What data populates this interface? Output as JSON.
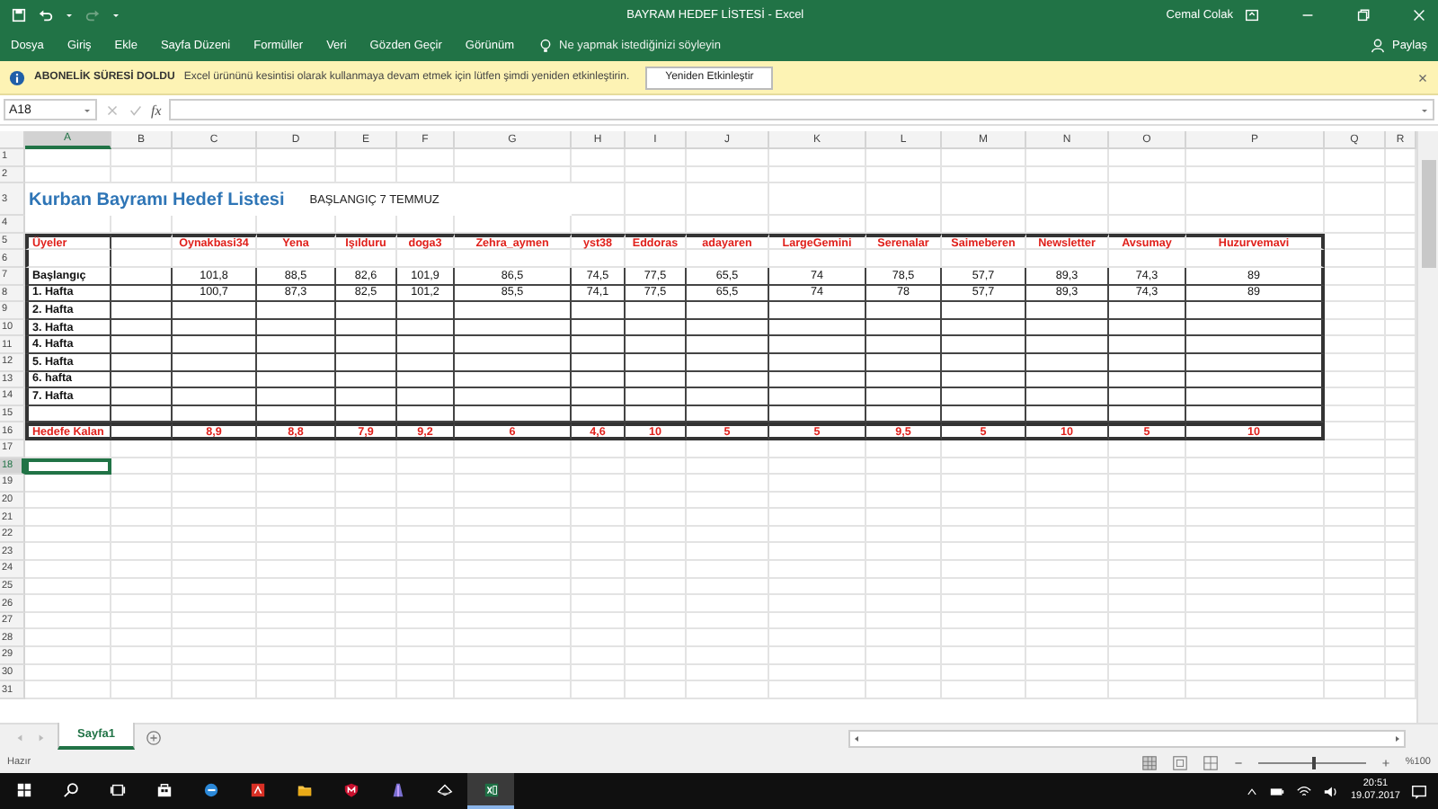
{
  "title_bar": {
    "title": "BAYRAM HEDEF LİSTESİ  -  Excel",
    "user": "Cemal Colak"
  },
  "ribbon": {
    "tabs": [
      "Dosya",
      "Giriş",
      "Ekle",
      "Sayfa Düzeni",
      "Formüller",
      "Veri",
      "Gözden Geçir",
      "Görünüm"
    ],
    "tell_me": "Ne yapmak istediğinizi söyleyin",
    "share": "Paylaş"
  },
  "message_bar": {
    "title": "ABONELİK SÜRESİ DOLDU",
    "text": "Excel ürününü kesintisi olarak kullanmaya devam etmek için lütfen şimdi yeniden etkinleştirin.",
    "button": "Yeniden Etkinleştir"
  },
  "formula_bar": {
    "name_box": "A18",
    "function_label": "fx"
  },
  "columns": [
    {
      "label": "A",
      "selected": true
    },
    {
      "label": "B",
      "selected": false
    },
    {
      "label": "C",
      "selected": false
    },
    {
      "label": "D",
      "selected": false
    },
    {
      "label": "E",
      "selected": false
    },
    {
      "label": "F",
      "selected": false
    },
    {
      "label": "G",
      "selected": false
    },
    {
      "label": "H",
      "selected": false
    },
    {
      "label": "I",
      "selected": false
    },
    {
      "label": "J",
      "selected": false
    },
    {
      "label": "K",
      "selected": false
    },
    {
      "label": "L",
      "selected": false
    },
    {
      "label": "M",
      "selected": false
    },
    {
      "label": "N",
      "selected": false
    },
    {
      "label": "O",
      "selected": false
    },
    {
      "label": "P",
      "selected": false
    },
    {
      "label": "Q",
      "selected": false
    },
    {
      "label": "R",
      "selected": false
    }
  ],
  "row_numbers": [
    {
      "label": "1",
      "selected": false
    },
    {
      "label": "2",
      "selected": false
    },
    {
      "label": "3",
      "selected": false
    },
    {
      "label": "4",
      "selected": false
    },
    {
      "label": "5",
      "selected": false
    },
    {
      "label": "6",
      "selected": false
    },
    {
      "label": "7",
      "selected": false
    },
    {
      "label": "8",
      "selected": false
    },
    {
      "label": "9",
      "selected": false
    },
    {
      "label": "10",
      "selected": false
    },
    {
      "label": "11",
      "selected": false
    },
    {
      "label": "12",
      "selected": false
    },
    {
      "label": "13",
      "selected": false
    },
    {
      "label": "14",
      "selected": false
    },
    {
      "label": "15",
      "selected": false
    },
    {
      "label": "16",
      "selected": false
    },
    {
      "label": "17",
      "selected": false
    },
    {
      "label": "18",
      "selected": true
    },
    {
      "label": "19",
      "selected": false
    },
    {
      "label": "20",
      "selected": false
    },
    {
      "label": "21",
      "selected": false
    },
    {
      "label": "22",
      "selected": false
    },
    {
      "label": "23",
      "selected": false
    },
    {
      "label": "24",
      "selected": false
    },
    {
      "label": "25",
      "selected": false
    },
    {
      "label": "26",
      "selected": false
    },
    {
      "label": "27",
      "selected": false
    },
    {
      "label": "28",
      "selected": false
    },
    {
      "label": "29",
      "selected": false
    },
    {
      "label": "30",
      "selected": false
    },
    {
      "label": "31",
      "selected": false
    }
  ],
  "sheet": {
    "title": "Kurban Bayramı Hedef Listesi",
    "subtitle": "BAŞLANGIÇ 7 TEMMUZ",
    "header_label": "Üyeler",
    "members": [
      "Oynakbasi34",
      "Yena",
      "Işılduru",
      "doga3",
      "Zehra_aymen",
      "yst38",
      "Eddoras",
      "adayaren",
      "LargeGemini",
      "Serenalar",
      "Saimeberen",
      "Newsletter",
      "Avsumay",
      "Huzurvemavi"
    ],
    "rows": [
      {
        "label": "Başlangıç",
        "values": [
          "101,8",
          "88,5",
          "82,6",
          "101,9",
          "86,5",
          "74,5",
          "77,5",
          "65,5",
          "74",
          "78,5",
          "57,7",
          "89,3",
          "74,3",
          "89"
        ]
      },
      {
        "label": "1. Hafta",
        "values": [
          "100,7",
          "87,3",
          "82,5",
          "101,2",
          "85,5",
          "74,1",
          "77,5",
          "65,5",
          "74",
          "78",
          "57,7",
          "89,3",
          "74,3",
          "89"
        ]
      },
      {
        "label": "2. Hafta"
      },
      {
        "label": "3. Hafta"
      },
      {
        "label": "4. Hafta"
      },
      {
        "label": "5. Hafta"
      },
      {
        "label": "6. hafta"
      },
      {
        "label": "7. Hafta"
      }
    ],
    "remaining": {
      "label": "Hedefe Kalan",
      "values": [
        "8,9",
        "8,8",
        "7,9",
        "9,2",
        "6",
        "4,6",
        "10",
        "5",
        "5",
        "9,5",
        "5",
        "10",
        "5",
        "10"
      ]
    }
  },
  "sheet_tabs": [
    {
      "label": "Sayfa1",
      "selected": true
    }
  ],
  "status_bar": {
    "status": "Hazır",
    "zoom": "%100",
    "level": 0.5
  },
  "taskbar": {
    "apps": [
      {
        "kind": "start",
        "active": false
      },
      {
        "kind": "search",
        "active": false
      },
      {
        "kind": "taskview",
        "active": false
      },
      {
        "kind": "store",
        "active": false
      },
      {
        "kind": "browser",
        "active": false
      },
      {
        "kind": "pdf",
        "active": false
      },
      {
        "kind": "folder",
        "active": false
      },
      {
        "kind": "shield",
        "active": false
      },
      {
        "kind": "app",
        "active": false
      },
      {
        "kind": "cloud",
        "active": false
      },
      {
        "kind": "excel",
        "active": true
      }
    ],
    "time": "20:51",
    "date": "19.07.2017"
  }
}
